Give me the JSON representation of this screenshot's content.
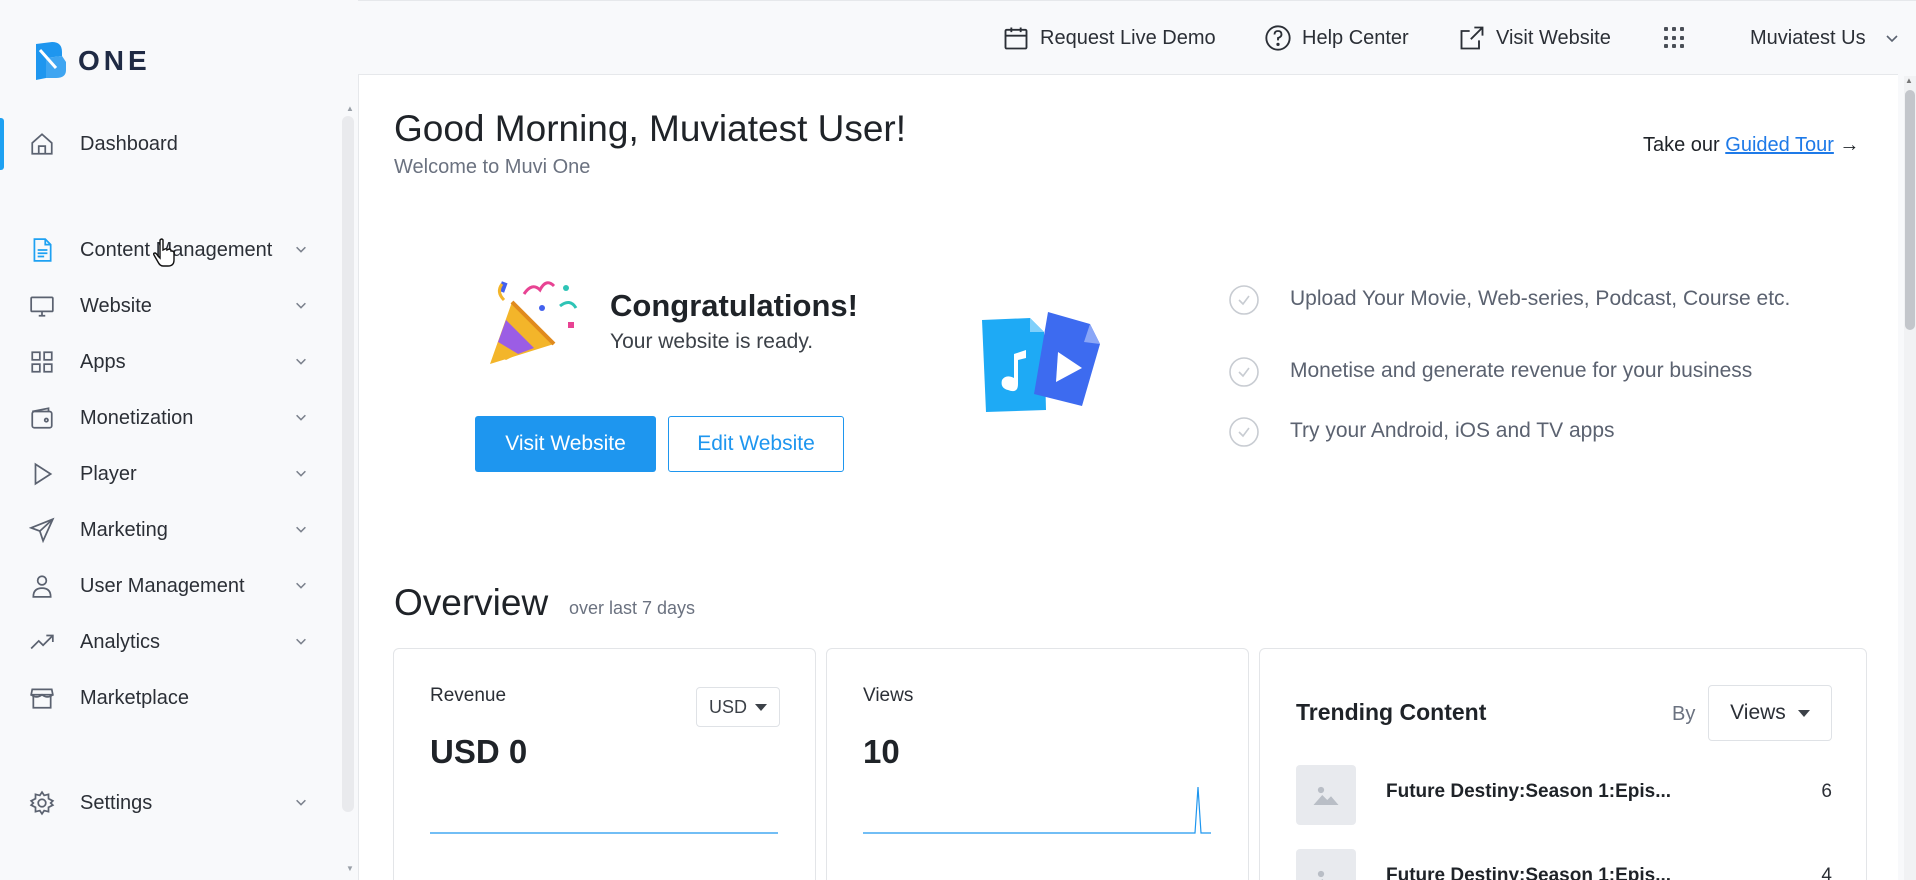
{
  "brand": {
    "logo_text": "ONE"
  },
  "topbar": {
    "request_demo": "Request Live Demo",
    "help_center": "Help Center",
    "visit_website": "Visit Website",
    "user_name": "Muviatest Us"
  },
  "sidebar": {
    "items": [
      {
        "label": "Dashboard",
        "icon": "home-icon",
        "expandable": false
      },
      {
        "label": "Content Management",
        "icon": "document-icon",
        "expandable": true
      },
      {
        "label": "Website",
        "icon": "monitor-icon",
        "expandable": true
      },
      {
        "label": "Apps",
        "icon": "grid-icon",
        "expandable": true
      },
      {
        "label": "Monetization",
        "icon": "wallet-icon",
        "expandable": true
      },
      {
        "label": "Player",
        "icon": "play-icon",
        "expandable": true
      },
      {
        "label": "Marketing",
        "icon": "send-icon",
        "expandable": true
      },
      {
        "label": "User Management",
        "icon": "user-icon",
        "expandable": true
      },
      {
        "label": "Analytics",
        "icon": "trend-icon",
        "expandable": true
      },
      {
        "label": "Marketplace",
        "icon": "store-icon",
        "expandable": false
      },
      {
        "label": "Settings",
        "icon": "gear-icon",
        "expandable": true
      }
    ]
  },
  "header": {
    "greeting": "Good Morning, Muviatest User!",
    "subtitle": "Welcome to Muvi One",
    "tour_prefix": "Take our ",
    "tour_link": "Guided Tour",
    "tour_arrow": "→"
  },
  "hero": {
    "title": "Congratulations!",
    "subtitle": "Your website is ready.",
    "visit_button": "Visit Website",
    "edit_button": "Edit Website",
    "checklist": [
      "Upload Your Movie, Web-series, Podcast, Course etc.",
      "Monetise and generate revenue for your business",
      "Try your Android, iOS and TV apps"
    ]
  },
  "overview": {
    "title": "Overview",
    "period": "over last 7 days",
    "revenue": {
      "label": "Revenue",
      "value": "USD 0",
      "currency": "USD"
    },
    "views": {
      "label": "Views",
      "value": "10"
    },
    "trending": {
      "title": "Trending Content",
      "by_label": "By",
      "by_value": "Views",
      "rows": [
        {
          "name": "Future Destiny:Season 1:Epis...",
          "count": "6"
        },
        {
          "name": "Future Destiny:Season 1:Epis...",
          "count": "4"
        }
      ]
    }
  },
  "colors": {
    "accent": "#1e96ef",
    "text": "#1f2328",
    "muted": "#6b7280"
  }
}
